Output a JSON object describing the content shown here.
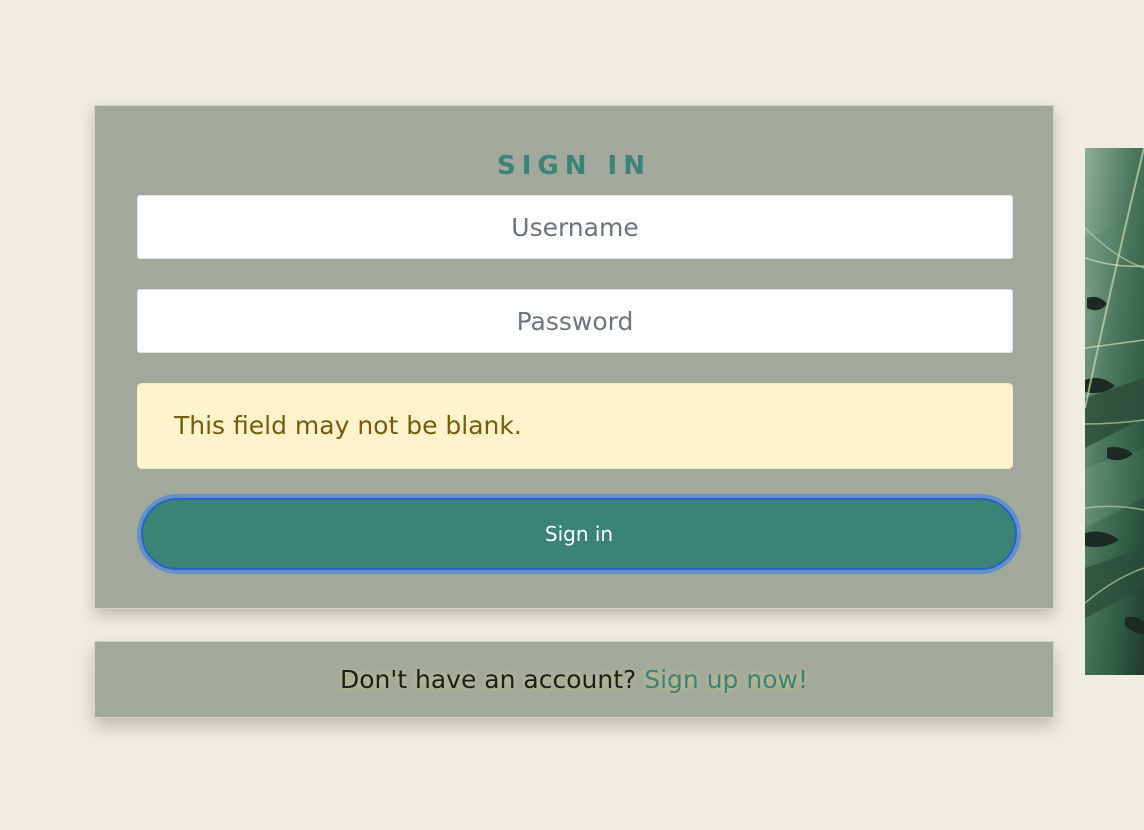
{
  "signin": {
    "title": "SIGN IN",
    "username_placeholder": "Username",
    "password_placeholder": "Password",
    "error_message": "This field may not be blank.",
    "button_label": "Sign in"
  },
  "footer": {
    "prompt": "Don't have an account?",
    "link_label": "Sign up now!"
  },
  "image": {
    "icon": "monstera-leaf-photo"
  },
  "colors": {
    "page_background": "#f0ece1",
    "card_background": "#a2a89c",
    "accent": "#3b8378",
    "alert_background": "#fff2cc",
    "alert_text": "#7a5a0c",
    "focus_ring": "#4384e0"
  }
}
